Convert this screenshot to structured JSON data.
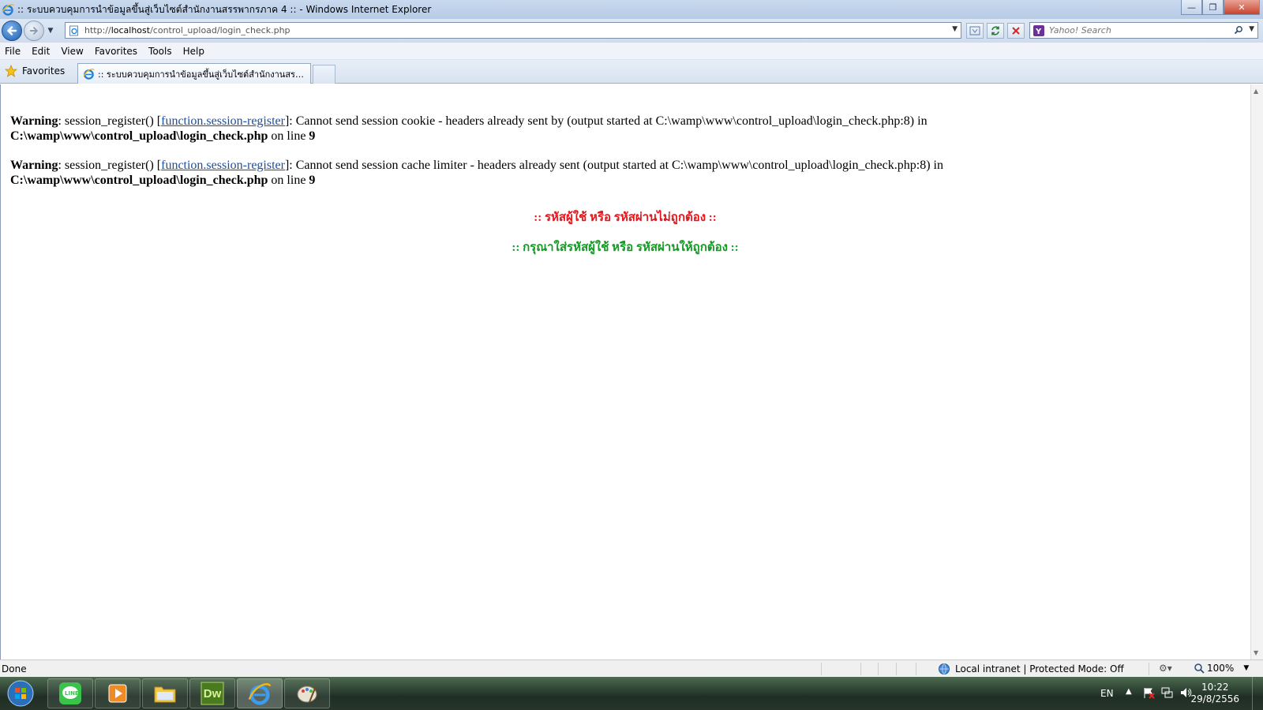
{
  "window": {
    "title": ":: ระบบควบคุมการนำข้อมูลขึ้นสู่เว็บไซต์สำนักงานสรรพากรภาค 4 :: - Windows Internet Explorer",
    "min_label": "—",
    "max_label": "❐",
    "close_label": "✕"
  },
  "address": {
    "url_prefix": "http://",
    "url_host": "localhost",
    "url_path": "/control_upload/login_check.php"
  },
  "search": {
    "placeholder": "Yahoo! Search"
  },
  "menu": {
    "file": "File",
    "edit": "Edit",
    "view": "View",
    "favorites": "Favorites",
    "tools": "Tools",
    "help": "Help"
  },
  "favorites_bar": {
    "label": "Favorites"
  },
  "tab": {
    "title": ":: ระบบควบคุมการนำข้อมูลขึ้นสู่เว็บไซต์สำนักงานสรรพา..."
  },
  "page": {
    "warnings": [
      {
        "label": "Warning",
        "fn": "session_register()",
        "link": "function.session-register",
        "message": ": Cannot send session cookie - headers already sent by (output started at C:\\wamp\\www\\control_upload\\login_check.php:8) in",
        "file": "C:\\wamp\\www\\control_upload\\login_check.php",
        "online": "on line",
        "line": "9"
      },
      {
        "label": "Warning",
        "fn": "session_register()",
        "link": "function.session-register",
        "message": ": Cannot send session cache limiter - headers already sent (output started at C:\\wamp\\www\\control_upload\\login_check.php:8) in",
        "file": "C:\\wamp\\www\\control_upload\\login_check.php",
        "online": "on line",
        "line": "9"
      }
    ],
    "error_message": ":: รหัสผู้ใช้ หรือ รหัสผ่านไม่ถูกต้อง ::",
    "hint_message": ":: กรุณาใส่รหัสผู้ใช้ หรือ รหัสผ่านให้ถูกต้อง ::"
  },
  "statusbar": {
    "status": "Done",
    "zone": "Local intranet | Protected Mode: Off",
    "zoom": "100%"
  },
  "taskbar": {
    "lang": "EN",
    "time": "10:22",
    "date": "29/8/2556",
    "apps": [
      "line-app",
      "media-player",
      "file-explorer",
      "dreamweaver",
      "internet-explorer",
      "paint"
    ],
    "dw_label": "Dw"
  },
  "colors": {
    "error_red": "#e4141b",
    "hint_green": "#139924",
    "link_blue": "#1a4ea3"
  }
}
